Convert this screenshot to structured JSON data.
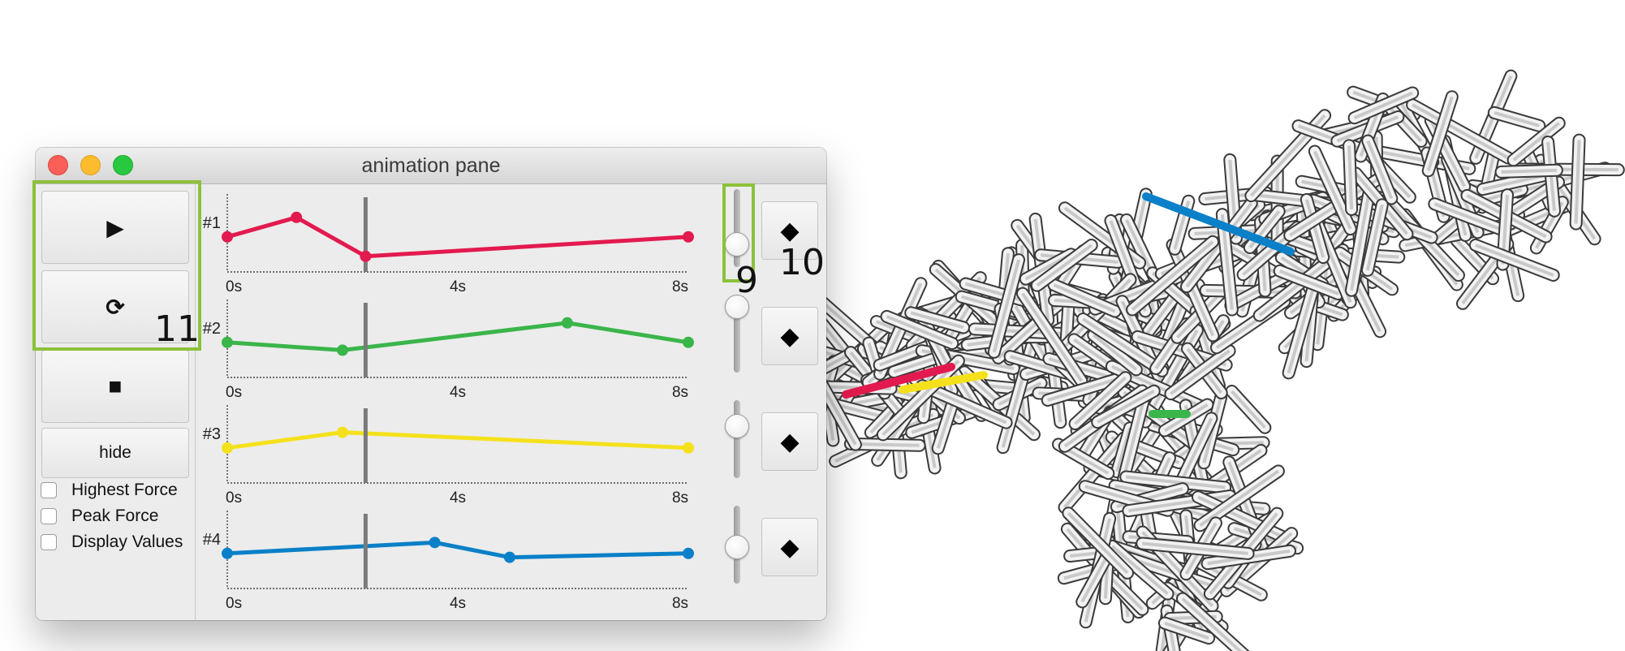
{
  "window": {
    "title": "animation pane"
  },
  "controls": {
    "play_icon": "play-icon",
    "play_glyph": "▶",
    "reset_icon": "reset-icon",
    "reset_glyph": "⟳",
    "stop_icon": "stop-icon",
    "stop_glyph": "■",
    "hide_label": "hide"
  },
  "checkboxes": [
    {
      "label": "Highest Force",
      "checked": false
    },
    {
      "label": "Peak Force",
      "checked": false
    },
    {
      "label": "Display Values",
      "checked": false
    }
  ],
  "timeline": {
    "time_ticks": [
      "0s",
      "4s",
      "8s"
    ],
    "current_time": 2.4
  },
  "chart_data": [
    {
      "type": "line",
      "label": "#1",
      "color": "#e31a4f",
      "x": [
        0,
        1.2,
        2.4,
        8
      ],
      "y": [
        0.45,
        0.7,
        0.2,
        0.45
      ],
      "xlim": [
        0,
        8
      ],
      "ylim": [
        0,
        1
      ]
    },
    {
      "type": "line",
      "label": "#2",
      "color": "#3ab54a",
      "x": [
        0,
        2.0,
        5.9,
        8
      ],
      "y": [
        0.45,
        0.35,
        0.7,
        0.45
      ],
      "xlim": [
        0,
        8
      ],
      "ylim": [
        0,
        1
      ]
    },
    {
      "type": "line",
      "label": "#3",
      "color": "#f5e11b",
      "x": [
        0,
        2.0,
        8
      ],
      "y": [
        0.45,
        0.65,
        0.45
      ],
      "xlim": [
        0,
        8
      ],
      "ylim": [
        0,
        1
      ]
    },
    {
      "type": "line",
      "label": "#4",
      "color": "#0a80c8",
      "x": [
        0,
        3.6,
        4.9,
        8
      ],
      "y": [
        0.45,
        0.59,
        0.4,
        0.45
      ],
      "xlim": [
        0,
        8
      ],
      "ylim": [
        0,
        1
      ]
    }
  ],
  "sliders": [
    {
      "value": 0.2
    },
    {
      "value": 1.0
    },
    {
      "value": 0.75
    },
    {
      "value": 0.45
    }
  ],
  "keyframe_buttons": {
    "icon": "diamond-icon",
    "glyph": "◆"
  },
  "annotations": [
    "9",
    "10",
    "11"
  ],
  "model": {
    "members": [
      {
        "color": "#e31a4f"
      },
      {
        "color": "#f5e11b"
      },
      {
        "color": "#3ab54a"
      },
      {
        "color": "#0a80c8"
      }
    ]
  }
}
